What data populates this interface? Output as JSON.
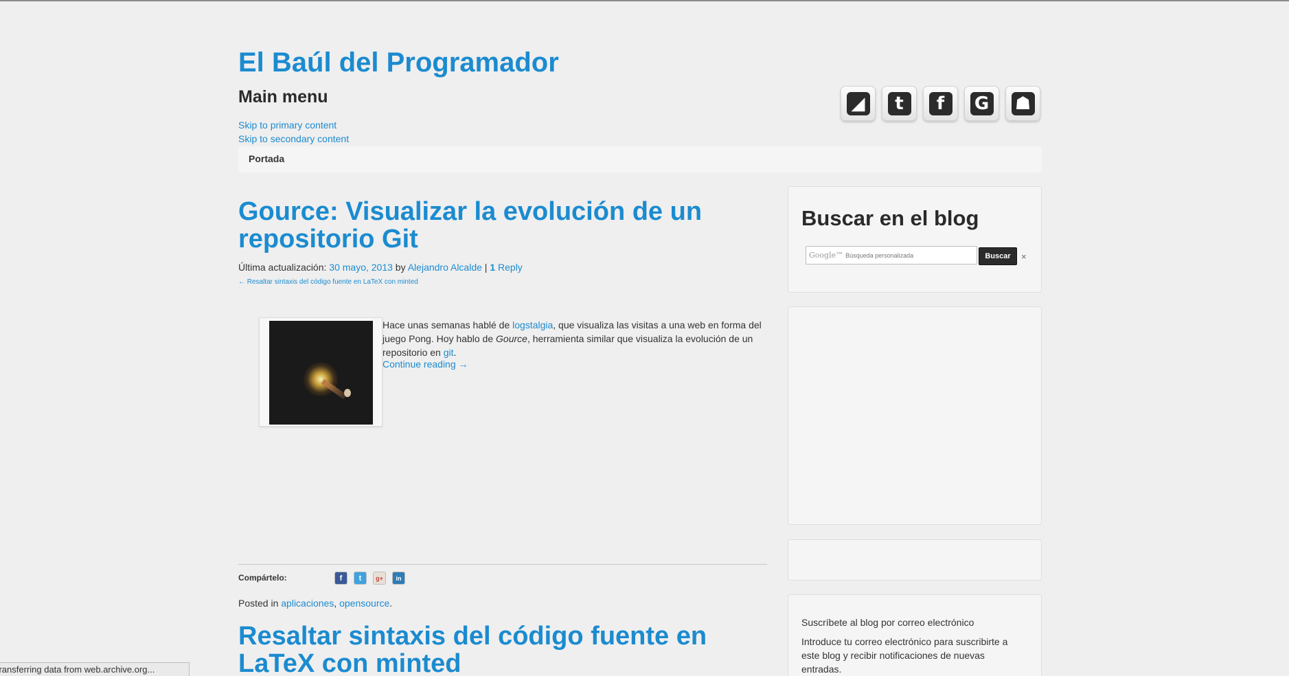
{
  "site": {
    "title": "El Baúl del Programador"
  },
  "menu": {
    "heading": "Main menu",
    "skip_primary": "Skip to primary content",
    "skip_secondary": "Skip to secondary content",
    "nav_items": [
      "Portada"
    ]
  },
  "social_icons": [
    {
      "name": "rss-icon",
      "glyph": "◢"
    },
    {
      "name": "twitter-icon",
      "glyph": "t"
    },
    {
      "name": "facebook-icon",
      "glyph": "f"
    },
    {
      "name": "google-icon",
      "glyph": "G"
    },
    {
      "name": "github-icon",
      "glyph": "☗"
    }
  ],
  "post": {
    "title": "Gource: Visualizar la evolución de un repositorio Git",
    "meta_prefix": "Última actualización:",
    "date": "30 mayo, 2013",
    "by": "by",
    "author": "Alejandro Alcalde",
    "separator": "|",
    "reply_count": "1",
    "reply_label": "Reply",
    "prev_link": "← Resaltar sintaxis del código fuente en LaTeX con minted",
    "excerpt_1": "Hace unas semanas hablé de ",
    "excerpt_link_1": "logstalgia",
    "excerpt_2": ", que visualiza las visitas a una web en forma del juego Pong. Hoy hablo de ",
    "excerpt_em": "Gource",
    "excerpt_3": ", herramienta similar que visualiza la evolución de un repositorio en ",
    "excerpt_link_2": "git",
    "excerpt_4": ".",
    "continue": "Continue reading →",
    "share_label": "Compártelo:",
    "posted_in": "Posted in ",
    "category_1": "aplicaciones",
    "comma": ", ",
    "category_2": "opensource",
    "period": "."
  },
  "share_icons": [
    {
      "name": "facebook-share-icon",
      "glyph": "f",
      "color": "#3b5998"
    },
    {
      "name": "twitter-share-icon",
      "glyph": "t",
      "color": "#3fa3e0"
    },
    {
      "name": "googleplus-share-icon",
      "glyph": "g+",
      "color": "#e8e0d8"
    },
    {
      "name": "linkedin-share-icon",
      "glyph": "in",
      "color": "#2f7cb6"
    }
  ],
  "post2": {
    "title": "Resaltar sintaxis del código fuente en LaTeX con minted"
  },
  "sidebar": {
    "search_title": "Buscar en el blog",
    "search_brand": "Google™",
    "search_placeholder": "Búsqueda personalizada",
    "search_button": "Buscar",
    "search_clear": "×",
    "subscribe_title": "Suscríbete al blog por correo electrónico",
    "subscribe_desc": "Introduce tu correo electrónico para suscribirte a este blog y recibir notificaciones de nuevas entradas."
  },
  "status": {
    "text": "Transferring data from web.archive.org..."
  },
  "colors": {
    "link": "#1b8bd0",
    "background": "#efefef",
    "panel": "#f5f5f5"
  }
}
